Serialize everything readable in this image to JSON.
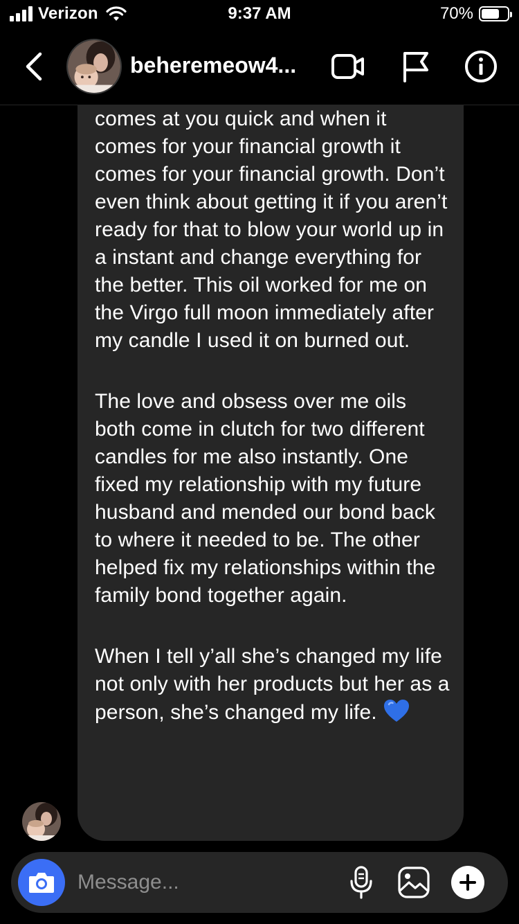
{
  "status_bar": {
    "carrier": "Verizon",
    "time": "9:37 AM",
    "battery_percent": "70%",
    "battery_level": 0.7,
    "icons": [
      "signal-icon",
      "wifi-icon",
      "battery-icon"
    ]
  },
  "header": {
    "username": "beheremeow4...",
    "icons": [
      "back-chevron-icon",
      "video-call-icon",
      "flag-icon",
      "info-icon"
    ]
  },
  "message": {
    "paragraphs": [
      "comes at you quick and when it comes for your financial growth it comes for your financial growth. Don’t even think about getting it if you aren’t ready for that to blow your world up in a instant and change everything for the better. This oil worked for me on the Virgo full moon immediately after my candle I used it on burned out.",
      "The love and obsess over me oils both come in clutch for two different candles for me also instantly. One fixed my relationship with my future husband and mended our bond back to where it needed to be. The other helped fix my relationships within the family bond together again.",
      "When I tell y’all she’s changed my life not only with her products but her as a person, she’s changed my life."
    ],
    "emoji": "blue-heart-icon"
  },
  "composer": {
    "placeholder": "Message...",
    "accent_color": "#3b6ef5",
    "icons": [
      "camera-icon",
      "microphone-icon",
      "gallery-icon",
      "plus-icon"
    ]
  }
}
